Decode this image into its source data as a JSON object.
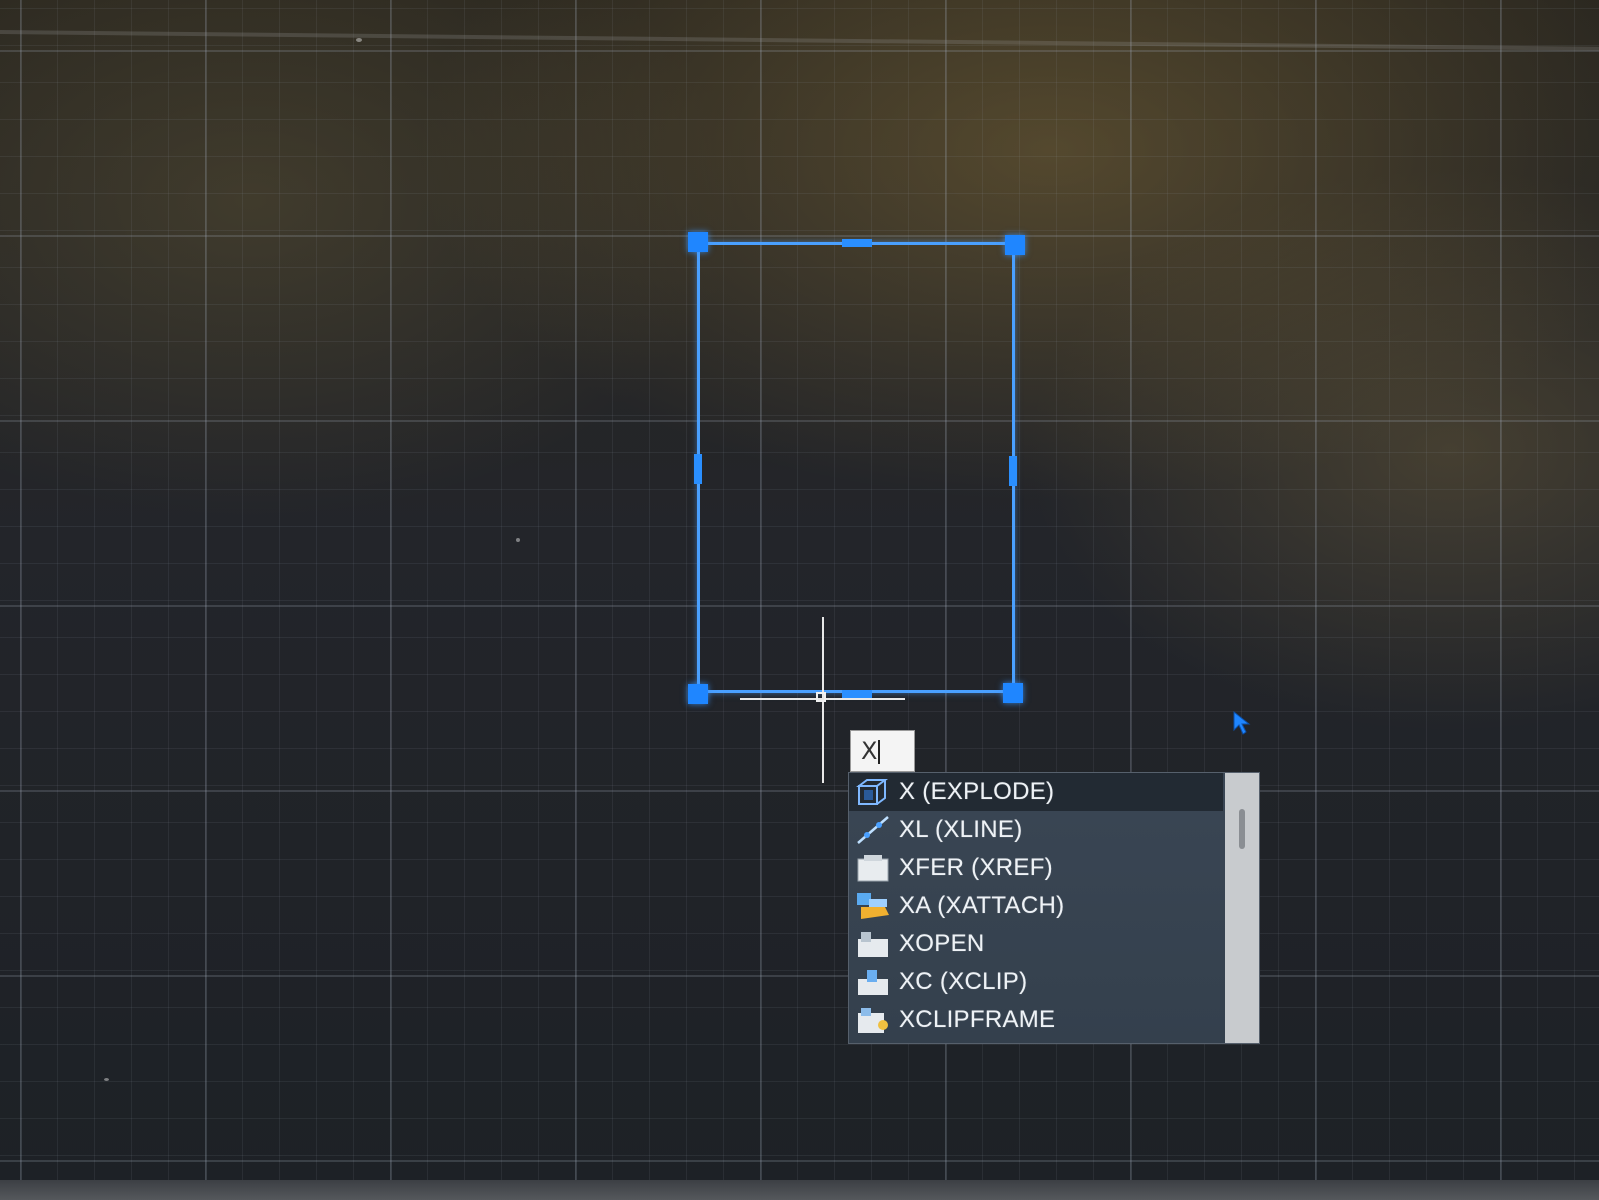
{
  "command_input": {
    "value": "X"
  },
  "autocomplete": {
    "items": [
      {
        "label": "X (EXPLODE)",
        "icon": "explode-icon",
        "highlighted": true
      },
      {
        "label": "XL (XLINE)",
        "icon": "xline-icon",
        "highlighted": false
      },
      {
        "label": "XFER (XREF)",
        "icon": "xref-icon",
        "highlighted": false
      },
      {
        "label": "XA (XATTACH)",
        "icon": "xattach-icon",
        "highlighted": false
      },
      {
        "label": "XOPEN",
        "icon": "xopen-icon",
        "highlighted": false
      },
      {
        "label": "XC (XCLIP)",
        "icon": "xclip-icon",
        "highlighted": false
      },
      {
        "label": "XCLIPFRAME",
        "icon": "xclipframe-icon",
        "highlighted": false
      }
    ]
  },
  "colors": {
    "selection": "#4aa0ff",
    "grip": "#1f86ff",
    "list_background": "#3a4654",
    "list_highlight": "#222a33",
    "scrollbar": "#c8cbce"
  }
}
